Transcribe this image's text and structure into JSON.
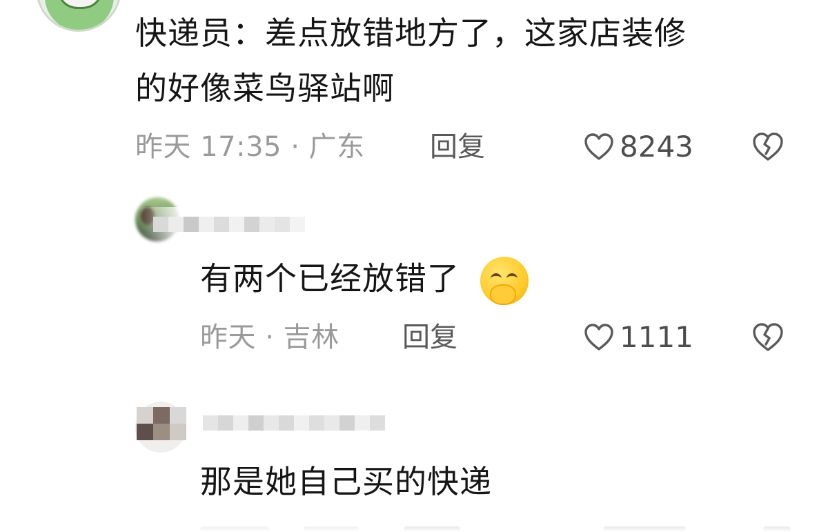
{
  "comment_main": {
    "text": "快递员：差点放错地方了，这家店装修的好像菜鸟驿站啊",
    "line1": "快递员：差点放错地方了，这家店装修",
    "line2": "的好像菜鸟驿站啊",
    "meta": "昨天 17:35 · 广东",
    "reply_label": "回复",
    "likes": "8243",
    "like_icon": "heart-outline-icon",
    "dislike_icon": "broken-heart-icon"
  },
  "reply_1": {
    "author_obscured": "",
    "text": "有两个已经放错了",
    "emoji": "smiling-face-with-hand-over-mouth",
    "meta": "昨天 · 吉林",
    "reply_label": "回复",
    "likes": "1111",
    "like_icon": "heart-outline-icon",
    "dislike_icon": "broken-heart-icon"
  },
  "reply_2": {
    "author_obscured": "",
    "text": "那是她自己买的快递",
    "meta_partial": "",
    "reply_label_partial": "",
    "likes_partial": ""
  },
  "colors": {
    "text": "#161616",
    "meta": "#9a9a9a",
    "reply": "#5a5a5a"
  }
}
